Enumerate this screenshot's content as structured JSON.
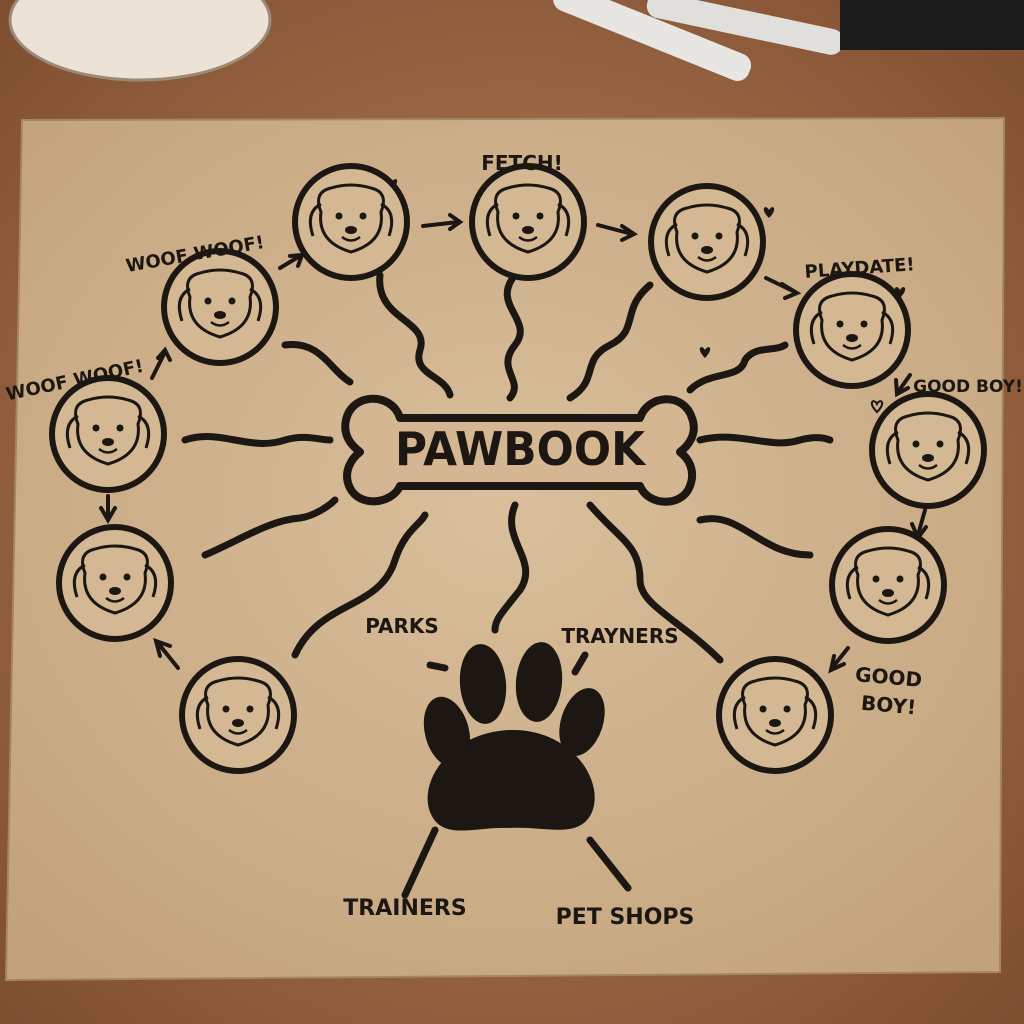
{
  "center_title": "PAWBOOK",
  "dog_labels": {
    "fetch": "FETCH!",
    "woof_top": "WOOF WOOF!",
    "woof_left": "WOOF WOOF!",
    "playdate": "PLAYDATE!",
    "good_boy_right": "GOOD BOY!",
    "good_boy_bottom_line1": "GOOD",
    "good_boy_bottom_line2": "BOY!"
  },
  "paw_labels": {
    "parks": "PARKS",
    "trayners": "TRAYNERS",
    "trainers": "TRAINERS",
    "pet_shops": "PET SHOPS"
  },
  "colors": {
    "desk": "#b07a52",
    "paper": "#d2b591",
    "ink": "#1c1712"
  },
  "dog_icons": [
    "golden-retriever-icon",
    "bulldog-icon",
    "pug-icon",
    "terrier-icon",
    "labrador-icon",
    "poodle-icon",
    "beagle-icon",
    "poodle-icon",
    "boxer-icon",
    "spaniel-icon",
    "shaggy-dog-icon"
  ]
}
